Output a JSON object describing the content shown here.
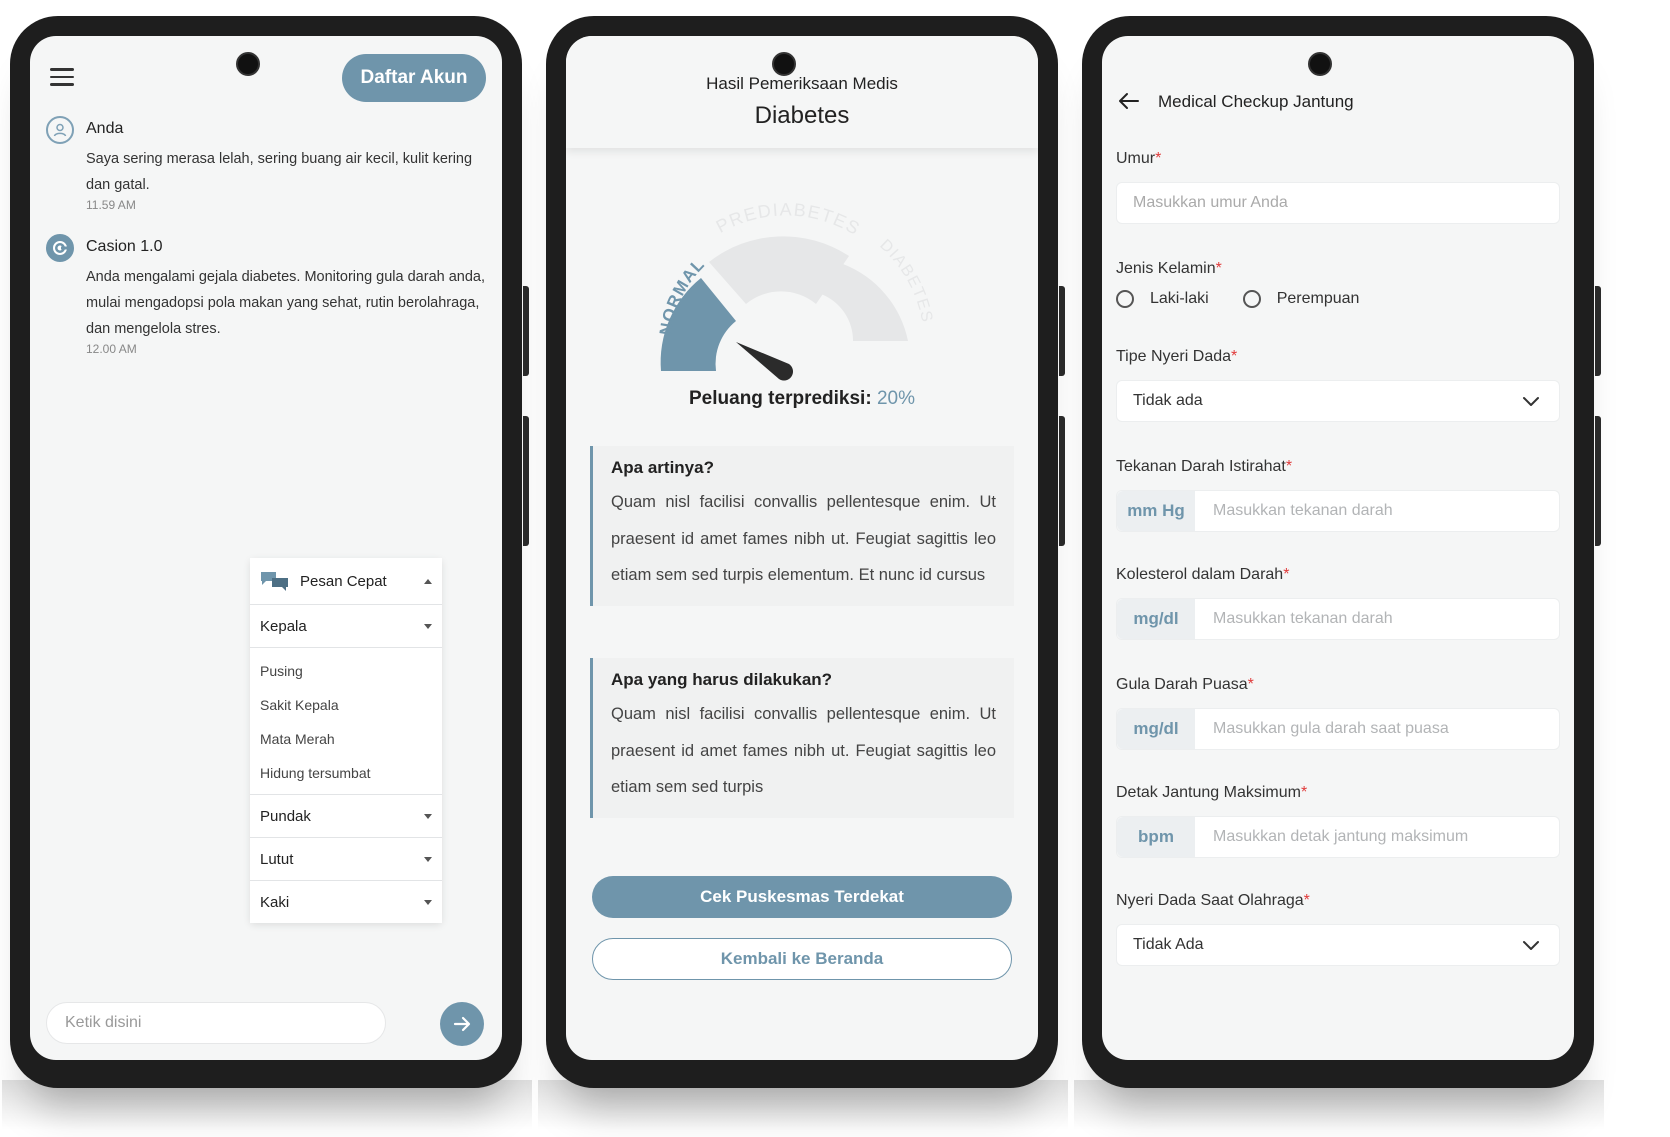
{
  "phone1": {
    "header": {
      "register_label": "Daftar Akun"
    },
    "messages": [
      {
        "sender": "Anda",
        "text": "Saya sering merasa lelah, sering buang air kecil, kulit kering dan gatal.",
        "time": "11.59 AM"
      },
      {
        "sender": "Casion 1.0",
        "text": "Anda mengalami gejala diabetes. Monitoring gula darah anda, mulai mengadopsi pola makan yang sehat, rutin berolahraga, dan mengelola stres.",
        "time": "12.00 AM"
      }
    ],
    "quick_messages": {
      "title": "Pesan Cepat",
      "categories": [
        {
          "label": "Kepala",
          "items": [
            "Pusing",
            "Sakit Kepala",
            "Mata Merah",
            "Hidung tersumbat"
          ]
        },
        {
          "label": "Pundak"
        },
        {
          "label": "Lutut"
        },
        {
          "label": "Kaki"
        }
      ]
    },
    "input": {
      "placeholder": "Ketik disini"
    }
  },
  "phone2": {
    "header": {
      "subtitle": "Hasil Pemeriksaan Medis",
      "title": "Diabetes"
    },
    "gauge": {
      "segments": [
        "NORMAL",
        "PREDIABETES",
        "DIABETES"
      ],
      "active_segment": "NORMAL",
      "colors": {
        "active": "#6f95ab",
        "inactive": "#e6e7e8",
        "needle": "#2b2b2b"
      }
    },
    "prediction": {
      "label": "Peluang terprediksi:",
      "value": "20%"
    },
    "info": [
      {
        "title": "Apa artinya?",
        "body": "Quam nisl facilisi convallis pellentesque enim. Ut praesent id amet fames nibh ut. Feugiat sagittis leo etiam sem sed turpis elementum. Et nunc id cursus"
      },
      {
        "title": "Apa yang harus dilakukan?",
        "body": "Quam nisl facilisi convallis pellentesque enim. Ut praesent id amet fames nibh ut. Feugiat sagittis leo etiam sem sed turpis"
      }
    ],
    "buttons": {
      "primary": "Cek Puskesmas Terdekat",
      "secondary": "Kembali ke Beranda"
    }
  },
  "phone3": {
    "header": {
      "title": "Medical Checkup Jantung"
    },
    "fields": {
      "age": {
        "label": "Umur",
        "placeholder": "Masukkan umur Anda"
      },
      "gender": {
        "label": "Jenis Kelamin",
        "options": [
          "Laki-laki",
          "Perempuan"
        ]
      },
      "chest_pain_type": {
        "label": "Tipe Nyeri Dada",
        "value": "Tidak ada"
      },
      "resting_bp": {
        "label": "Tekanan Darah Istirahat",
        "unit": "mm Hg",
        "placeholder": "Masukkan tekanan darah"
      },
      "cholesterol": {
        "label": "Kolesterol dalam Darah",
        "unit": "mg/dl",
        "placeholder": "Masukkan tekanan darah"
      },
      "fasting_sugar": {
        "label": "Gula Darah Puasa",
        "unit": "mg/dl",
        "placeholder": "Masukkan gula darah saat puasa"
      },
      "max_hr": {
        "label": "Detak Jantung Maksimum",
        "unit": "bpm",
        "placeholder": "Masukkan detak jantung maksimum"
      },
      "exercise_angina": {
        "label": "Nyeri Dada Saat Olahraga",
        "value": "Tidak Ada"
      }
    },
    "required_mark": "*"
  },
  "theme": {
    "accent": "#6f95ab",
    "required": "#e03a3a",
    "background": "#f5f6f6"
  }
}
